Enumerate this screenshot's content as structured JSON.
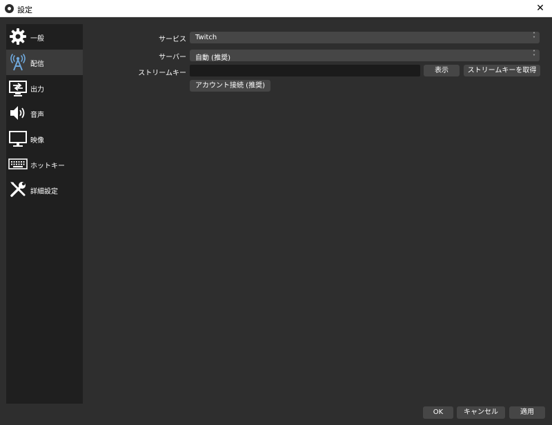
{
  "window": {
    "title": "設定",
    "close_glyph": "✕"
  },
  "sidebar": {
    "items": [
      {
        "label": "一般",
        "icon": "gear-icon",
        "active": false
      },
      {
        "label": "配信",
        "icon": "broadcast-antenna-icon",
        "active": true
      },
      {
        "label": "出力",
        "icon": "output-monitor-icon",
        "active": false
      },
      {
        "label": "音声",
        "icon": "speaker-icon",
        "active": false
      },
      {
        "label": "映像",
        "icon": "monitor-icon",
        "active": false
      },
      {
        "label": "ホットキー",
        "icon": "keyboard-icon",
        "active": false
      },
      {
        "label": "詳細設定",
        "icon": "tools-icon",
        "active": false
      }
    ]
  },
  "stream": {
    "service_label": "サービス",
    "service_value": "Twitch",
    "server_label": "サーバー",
    "server_value": "自動 (推奨)",
    "key_label": "ストリームキー",
    "key_value": "",
    "show_button": "表示",
    "get_key_button": "ストリームキーを取得",
    "connect_account_button": "アカウント接続 (推奨)"
  },
  "footer": {
    "ok": "OK",
    "cancel": "キャンセル",
    "apply": "適用"
  }
}
